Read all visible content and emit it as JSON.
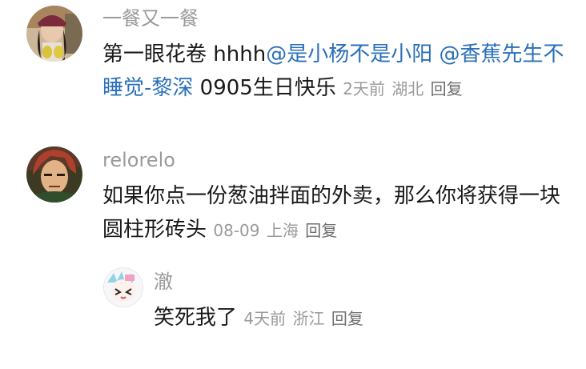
{
  "comments": [
    {
      "username": "一餐又一餐",
      "text_before": "第一眼花卷 hhhh",
      "mention1": "@是小杨不是小阳",
      "mention2": "@香蕉先生不睡觉-黎深",
      "text_after": "0905生日快乐",
      "time": "2天前",
      "location": "湖北",
      "reply_label": "回复"
    },
    {
      "username": "relorelo",
      "text": "如果你点一份葱油拌面的外卖，那么你将获得一块圆柱形砖头",
      "time": "08-09",
      "location": "上海",
      "reply_label": "回复"
    },
    {
      "username": "澈",
      "text": "笑死我了",
      "time": "4天前",
      "location": "浙江",
      "reply_label": "回复"
    }
  ]
}
